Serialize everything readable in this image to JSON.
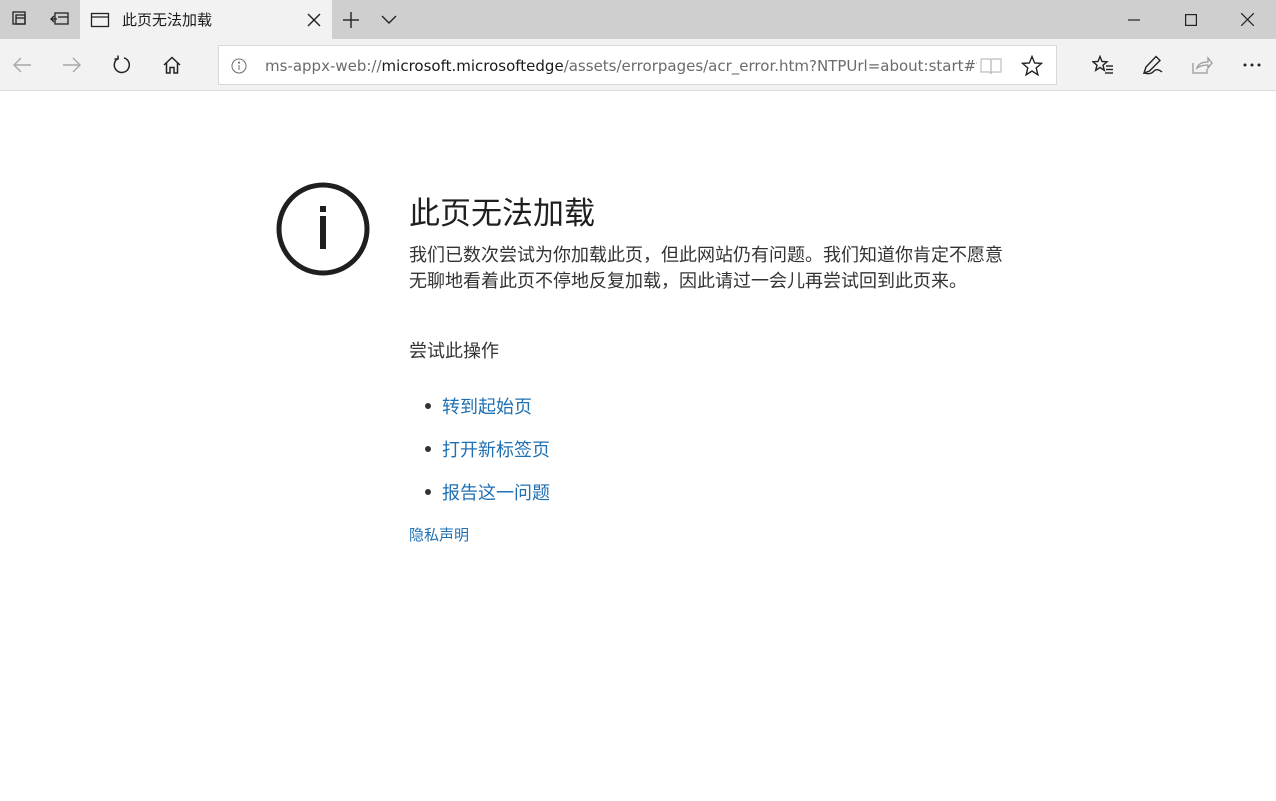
{
  "titlebar": {
    "tab": {
      "title": "此页无法加载",
      "icon": "page-icon",
      "close_icon": "close-icon"
    },
    "left_buttons": [
      "tabs-aside-icon",
      "set-tabs-aside-icon"
    ],
    "new_tab_icon": "plus-icon",
    "tab_list_icon": "chevron-down-icon",
    "window_controls": [
      "minimize-icon",
      "maximize-icon",
      "close-icon"
    ]
  },
  "navbar": {
    "buttons": [
      "back-arrow-icon",
      "forward-arrow-icon",
      "refresh-icon",
      "home-icon"
    ],
    "address": {
      "scheme": "ms-appx-web://",
      "host": "microsoft.microsoftedge",
      "path": "/assets/errorpages/acr_error.htm?NTPUrl=about:start#file://..."
    },
    "right_buttons": [
      "favorites-icon",
      "pen-icon",
      "share-icon",
      "more-icon"
    ]
  },
  "error": {
    "title": "此页无法加载",
    "description": "我们已数次尝试为你加载此页，但此网站仍有问题。我们知道你肯定不愿意无聊地看着此页不停地反复加载，因此请过一会儿再尝试回到此页来。",
    "try_heading": "尝试此操作",
    "actions": [
      "转到起始页",
      "打开新标签页",
      "报告这一问题"
    ],
    "privacy_link": "隐私声明"
  },
  "colors": {
    "link": "#1f6fb3",
    "titlebar": "#cfcfcf",
    "toolbar": "#f2f2f2"
  }
}
